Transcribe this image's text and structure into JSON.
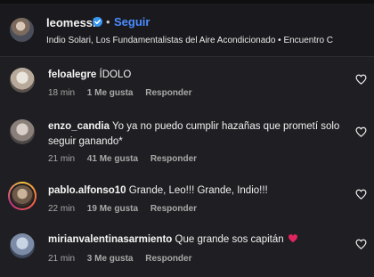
{
  "header": {
    "username": "leomessi",
    "separator": "•",
    "follow_label": "Seguir",
    "subtitle": "Indio Solari, Los Fundamentalistas del Aire Acondicionado • Encuentro C"
  },
  "comments": [
    {
      "user": "feloalegre",
      "text": "ÍDOLO",
      "time": "18 min",
      "likes": "1 Me gusta",
      "reply": "Responder",
      "avatar_colors": [
        "#e9e4dc",
        "#b7aa9a"
      ]
    },
    {
      "user": "enzo_candia",
      "text": "Yo ya no puedo cumplir hazañas que prometí solo seguir ganando*",
      "time": "21 min",
      "likes": "41 Me gusta",
      "reply": "Responder",
      "avatar_colors": [
        "#d8cfc8",
        "#8a7f79"
      ]
    },
    {
      "user": "pablo.alfonso10",
      "text": "Grande, Leo!!! Grande, Indio!!!",
      "time": "22 min",
      "likes": "19 Me gusta",
      "reply": "Responder",
      "avatar_colors": [
        "#c9b39a",
        "#6f5a49"
      ]
    },
    {
      "user": "mirianvalentinasarmiento",
      "text": "Que grande sos capitán",
      "time": "21 min",
      "likes": "3 Me gusta",
      "reply": "Responder",
      "avatar_colors": [
        "#c8d4e4",
        "#7c8ca6"
      ]
    }
  ],
  "icons": {
    "verified": "verified-badge-icon",
    "like": "heart-outline-icon",
    "emoji": "red-heart-emoji"
  },
  "colors": {
    "background": "#1f1f23",
    "link": "#4a8cff",
    "verified": "#3897f0",
    "emoji_heart": "#e0245e"
  }
}
